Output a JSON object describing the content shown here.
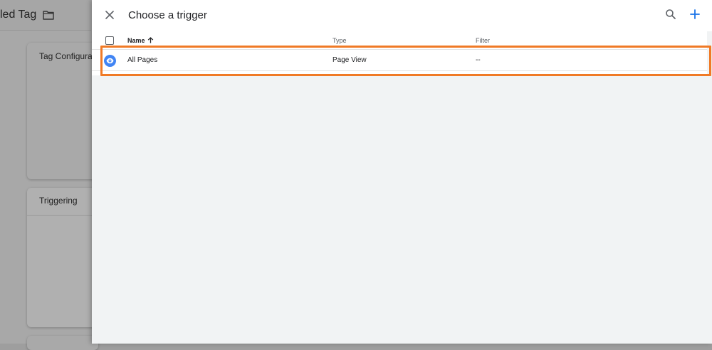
{
  "background": {
    "header_title": "itled Tag",
    "cards": [
      {
        "title": "Tag Configurati"
      },
      {
        "title": "Triggering"
      }
    ]
  },
  "panel": {
    "title": "Choose a trigger",
    "icons": {
      "close": "close-icon",
      "search": "search-icon",
      "add": "add-icon"
    },
    "accent": "#1a73e8"
  },
  "table": {
    "columns": {
      "name": "Name",
      "type": "Type",
      "filter": "Filter"
    },
    "sort": {
      "column": "name",
      "direction": "ascending"
    },
    "rows": [
      {
        "icon": "eye-icon",
        "name": "All Pages",
        "type": "Page View",
        "filter": "--"
      }
    ]
  },
  "annotation": {
    "color": "#f07a26"
  }
}
